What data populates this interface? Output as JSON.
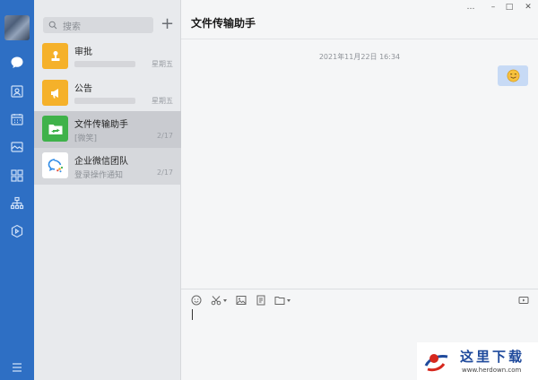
{
  "rail": {
    "icons": [
      "chat-icon",
      "contacts-icon",
      "calendar-icon",
      "mail-icon",
      "apps-icon",
      "org-chart-icon",
      "box-icon",
      "menu-icon"
    ]
  },
  "list": {
    "search_placeholder": "搜索",
    "add_label": "+",
    "conversations": [
      {
        "name": "审批",
        "preview": "",
        "time": "星期五",
        "avatar_color": "#f5b12a",
        "icon": "stamp-icon"
      },
      {
        "name": "公告",
        "preview": "",
        "time": "星期五",
        "avatar_color": "#f5b12a",
        "icon": "megaphone-icon"
      },
      {
        "name": "文件传输助手",
        "preview": "[微笑]",
        "time": "2/17",
        "avatar_color": "#3fb24a",
        "icon": "folder-transfer-icon"
      },
      {
        "name": "企业微信团队",
        "preview": "登录操作通知",
        "time": "2/17",
        "avatar_color": "#ffffff",
        "icon": "wecom-logo-icon"
      }
    ]
  },
  "chat": {
    "title": "文件传输助手",
    "timestamp": "2021年11月22日 16:34",
    "message_emoji": "😊",
    "window_controls": [
      "…",
      "–",
      "□",
      "✕"
    ],
    "accent_color": "#2e6fc4"
  },
  "watermark": {
    "title": "这里下载",
    "url": "www.herdown.com"
  }
}
